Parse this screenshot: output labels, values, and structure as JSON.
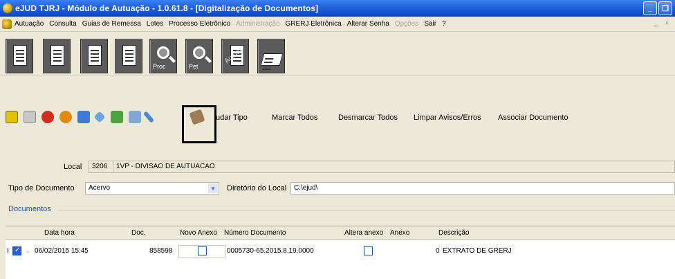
{
  "window": {
    "title": "eJUD TJRJ - Módulo de Autuação - 1.0.61.8 - [Digitalização de Documentos]",
    "controls": [
      "minimize",
      "restore"
    ]
  },
  "menu": {
    "items": [
      {
        "label": "Autuação",
        "enabled": true
      },
      {
        "label": "Consulta",
        "enabled": true
      },
      {
        "label": "Guias de Remessa",
        "enabled": true
      },
      {
        "label": "Lotes",
        "enabled": true
      },
      {
        "label": "Processo Eletrônico",
        "enabled": true
      },
      {
        "label": "Administração",
        "enabled": false
      },
      {
        "label": "GRERJ Eletrônica",
        "enabled": true
      },
      {
        "label": "Alterar Senha",
        "enabled": true
      },
      {
        "label": "Opções",
        "enabled": false
      },
      {
        "label": "Sair",
        "enabled": true
      },
      {
        "label": "?",
        "enabled": true
      }
    ],
    "mdi_controls": "_ ▫"
  },
  "big_toolbar": {
    "buttons": [
      {
        "icon": "document-icon",
        "caption": ""
      },
      {
        "icon": "document-edit-icon",
        "caption": ""
      },
      {
        "icon": "checklist-icon",
        "caption": ""
      },
      {
        "icon": "form-icon",
        "caption": ""
      },
      {
        "icon": "search-process-icon",
        "caption": "Proc"
      },
      {
        "icon": "search-petition-icon",
        "caption": "Pet"
      },
      {
        "icon": "autuar-icon",
        "caption": "Autuar"
      },
      {
        "icon": "scanner-icon",
        "caption": ""
      }
    ]
  },
  "small_toolbar": {
    "links": {
      "mudar_tipo": "udar Tipo",
      "marcar_todos": "Marcar Todos",
      "desmarcar_todos": "Desmarcar Todos",
      "limpar_avisos": "Limpar Avisos/Erros",
      "associar_documento": "Associar Documento"
    }
  },
  "form": {
    "local_label": "Local",
    "local_code": "3206",
    "local_name": "1VP - DIVISAO DE AUTUACAO",
    "tipo_documento_label": "Tipo de Documento",
    "tipo_documento_value": "Acervo",
    "diretorio_label": "Diretório do Local",
    "diretorio_value": "C:\\ejud\\"
  },
  "documents": {
    "group_label": "Documentos",
    "columns": {
      "data_hora": "Data hora",
      "doc": "Doc.",
      "novo_anexo": "Novo Anexo",
      "numero_documento": "Número Documento",
      "altera_anexo": "Altera anexo",
      "anexo": "Anexo",
      "descricao": "Descrição"
    },
    "rows": [
      {
        "marker": "I",
        "selected": true,
        "data_hora": "06/02/2015 15:45",
        "doc": "858598",
        "novo_anexo": false,
        "numero_documento": "0005730-65.2015.8.19.0000",
        "altera_anexo": false,
        "anexo": "0",
        "descricao": "EXTRATO DE GRERJ"
      }
    ]
  }
}
